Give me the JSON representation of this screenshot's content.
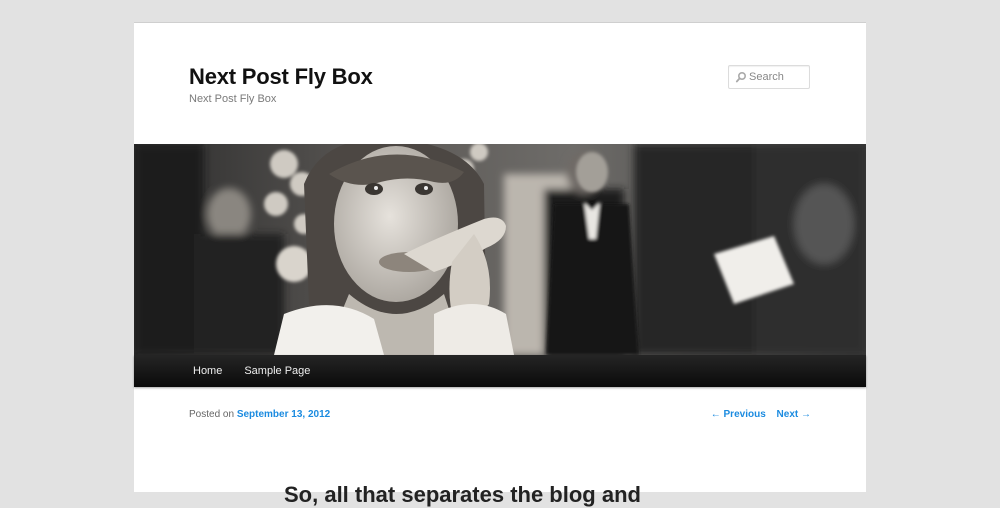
{
  "site": {
    "title": "Next Post Fly Box",
    "description": "Next Post Fly Box"
  },
  "search": {
    "placeholder": "Search",
    "icon": "search-icon"
  },
  "nav": {
    "items": [
      {
        "label": "Home"
      },
      {
        "label": "Sample Page"
      }
    ]
  },
  "post": {
    "posted_on_label": "Posted on",
    "date": "September 13, 2012",
    "title_partial": "So, all that separates the blog and"
  },
  "post_nav": {
    "previous": "← Previous",
    "next": "Next →"
  },
  "colors": {
    "page_background": "#e2e2e2",
    "content_background": "#ffffff",
    "menu_background": "#111111",
    "link": "#1b8be0"
  }
}
